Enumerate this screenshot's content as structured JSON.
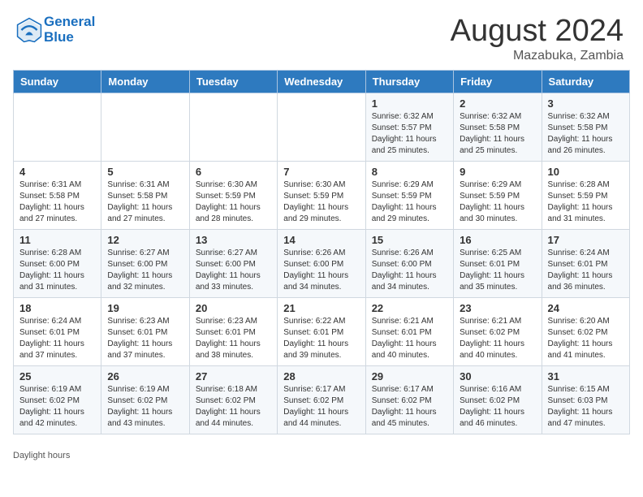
{
  "header": {
    "logo_text_general": "General",
    "logo_text_blue": "Blue",
    "month_year": "August 2024",
    "location": "Mazabuka, Zambia"
  },
  "days_of_week": [
    "Sunday",
    "Monday",
    "Tuesday",
    "Wednesday",
    "Thursday",
    "Friday",
    "Saturday"
  ],
  "weeks": [
    [
      {
        "day": "",
        "info": ""
      },
      {
        "day": "",
        "info": ""
      },
      {
        "day": "",
        "info": ""
      },
      {
        "day": "",
        "info": ""
      },
      {
        "day": "1",
        "info": "Sunrise: 6:32 AM\nSunset: 5:57 PM\nDaylight: 11 hours and 25 minutes."
      },
      {
        "day": "2",
        "info": "Sunrise: 6:32 AM\nSunset: 5:58 PM\nDaylight: 11 hours and 25 minutes."
      },
      {
        "day": "3",
        "info": "Sunrise: 6:32 AM\nSunset: 5:58 PM\nDaylight: 11 hours and 26 minutes."
      }
    ],
    [
      {
        "day": "4",
        "info": "Sunrise: 6:31 AM\nSunset: 5:58 PM\nDaylight: 11 hours and 27 minutes."
      },
      {
        "day": "5",
        "info": "Sunrise: 6:31 AM\nSunset: 5:58 PM\nDaylight: 11 hours and 27 minutes."
      },
      {
        "day": "6",
        "info": "Sunrise: 6:30 AM\nSunset: 5:59 PM\nDaylight: 11 hours and 28 minutes."
      },
      {
        "day": "7",
        "info": "Sunrise: 6:30 AM\nSunset: 5:59 PM\nDaylight: 11 hours and 29 minutes."
      },
      {
        "day": "8",
        "info": "Sunrise: 6:29 AM\nSunset: 5:59 PM\nDaylight: 11 hours and 29 minutes."
      },
      {
        "day": "9",
        "info": "Sunrise: 6:29 AM\nSunset: 5:59 PM\nDaylight: 11 hours and 30 minutes."
      },
      {
        "day": "10",
        "info": "Sunrise: 6:28 AM\nSunset: 5:59 PM\nDaylight: 11 hours and 31 minutes."
      }
    ],
    [
      {
        "day": "11",
        "info": "Sunrise: 6:28 AM\nSunset: 6:00 PM\nDaylight: 11 hours and 31 minutes."
      },
      {
        "day": "12",
        "info": "Sunrise: 6:27 AM\nSunset: 6:00 PM\nDaylight: 11 hours and 32 minutes."
      },
      {
        "day": "13",
        "info": "Sunrise: 6:27 AM\nSunset: 6:00 PM\nDaylight: 11 hours and 33 minutes."
      },
      {
        "day": "14",
        "info": "Sunrise: 6:26 AM\nSunset: 6:00 PM\nDaylight: 11 hours and 34 minutes."
      },
      {
        "day": "15",
        "info": "Sunrise: 6:26 AM\nSunset: 6:00 PM\nDaylight: 11 hours and 34 minutes."
      },
      {
        "day": "16",
        "info": "Sunrise: 6:25 AM\nSunset: 6:01 PM\nDaylight: 11 hours and 35 minutes."
      },
      {
        "day": "17",
        "info": "Sunrise: 6:24 AM\nSunset: 6:01 PM\nDaylight: 11 hours and 36 minutes."
      }
    ],
    [
      {
        "day": "18",
        "info": "Sunrise: 6:24 AM\nSunset: 6:01 PM\nDaylight: 11 hours and 37 minutes."
      },
      {
        "day": "19",
        "info": "Sunrise: 6:23 AM\nSunset: 6:01 PM\nDaylight: 11 hours and 37 minutes."
      },
      {
        "day": "20",
        "info": "Sunrise: 6:23 AM\nSunset: 6:01 PM\nDaylight: 11 hours and 38 minutes."
      },
      {
        "day": "21",
        "info": "Sunrise: 6:22 AM\nSunset: 6:01 PM\nDaylight: 11 hours and 39 minutes."
      },
      {
        "day": "22",
        "info": "Sunrise: 6:21 AM\nSunset: 6:01 PM\nDaylight: 11 hours and 40 minutes."
      },
      {
        "day": "23",
        "info": "Sunrise: 6:21 AM\nSunset: 6:02 PM\nDaylight: 11 hours and 40 minutes."
      },
      {
        "day": "24",
        "info": "Sunrise: 6:20 AM\nSunset: 6:02 PM\nDaylight: 11 hours and 41 minutes."
      }
    ],
    [
      {
        "day": "25",
        "info": "Sunrise: 6:19 AM\nSunset: 6:02 PM\nDaylight: 11 hours and 42 minutes."
      },
      {
        "day": "26",
        "info": "Sunrise: 6:19 AM\nSunset: 6:02 PM\nDaylight: 11 hours and 43 minutes."
      },
      {
        "day": "27",
        "info": "Sunrise: 6:18 AM\nSunset: 6:02 PM\nDaylight: 11 hours and 44 minutes."
      },
      {
        "day": "28",
        "info": "Sunrise: 6:17 AM\nSunset: 6:02 PM\nDaylight: 11 hours and 44 minutes."
      },
      {
        "day": "29",
        "info": "Sunrise: 6:17 AM\nSunset: 6:02 PM\nDaylight: 11 hours and 45 minutes."
      },
      {
        "day": "30",
        "info": "Sunrise: 6:16 AM\nSunset: 6:02 PM\nDaylight: 11 hours and 46 minutes."
      },
      {
        "day": "31",
        "info": "Sunrise: 6:15 AM\nSunset: 6:03 PM\nDaylight: 11 hours and 47 minutes."
      }
    ]
  ],
  "footer": {
    "daylight_hours": "Daylight hours"
  }
}
